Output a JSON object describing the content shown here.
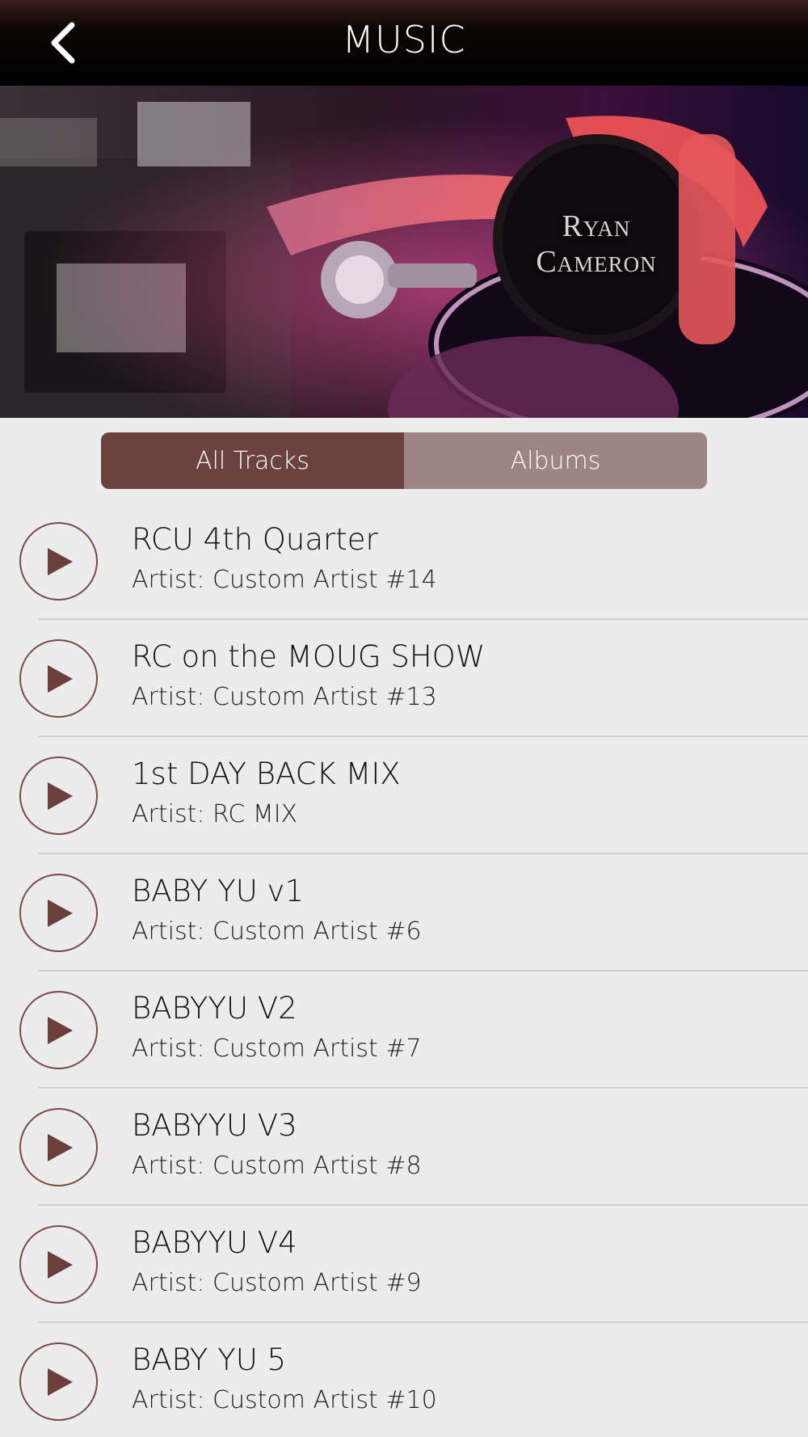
{
  "header": {
    "title": "MUSIC",
    "back_icon": "chevron-left-icon"
  },
  "banner": {
    "brand_line1": "Ryan",
    "brand_line2": "Cameron"
  },
  "tabs": [
    {
      "label": "All Tracks",
      "active": true
    },
    {
      "label": "Albums",
      "active": false
    }
  ],
  "colors": {
    "accent": "#6b4240",
    "accent_light": "#9e8482",
    "play_icon": "#6b3f3c"
  },
  "tracks": [
    {
      "title": "RCU 4th Quarter",
      "artist": "Artist: Custom Artist #14"
    },
    {
      "title": "RC on the MOUG SHOW",
      "artist": "Artist: Custom Artist #13"
    },
    {
      "title": "1st DAY BACK MIX",
      "artist": "Artist: RC MIX"
    },
    {
      "title": "BABY YU v1",
      "artist": "Artist: Custom Artist #6"
    },
    {
      "title": "BABYYU V2",
      "artist": "Artist: Custom Artist #7"
    },
    {
      "title": "BABYYU V3",
      "artist": "Artist: Custom Artist #8"
    },
    {
      "title": "BABYYU V4",
      "artist": "Artist: Custom Artist #9"
    },
    {
      "title": "BABY YU 5",
      "artist": "Artist: Custom Artist #10"
    }
  ]
}
